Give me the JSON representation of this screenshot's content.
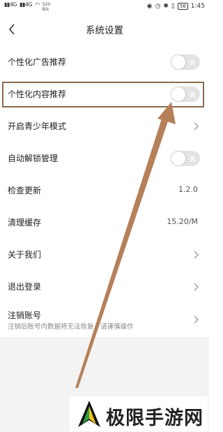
{
  "statusbar": {
    "signal_1": "4G",
    "signal_2": "4G",
    "net_speed_value": "520",
    "net_speed_unit": "B/s",
    "battery": "56",
    "time": "1:45"
  },
  "header": {
    "title": "系统设置"
  },
  "settings": {
    "personalized_ads": {
      "label": "个性化广告推荐",
      "toggle_label": "关",
      "on": false
    },
    "personalized_content": {
      "label": "个性化内容推荐",
      "toggle_label": "关",
      "on": false
    },
    "youth_mode": {
      "label": "开启青少年模式"
    },
    "auto_unlock": {
      "label": "自动解锁管理",
      "toggle_label": "关",
      "on": false
    },
    "check_update": {
      "label": "检查更新",
      "value": "1.2.0"
    },
    "clear_cache": {
      "label": "清理缓存",
      "value": "15.20/M"
    },
    "about": {
      "label": "关于我们"
    },
    "logout": {
      "label": "退出登录"
    },
    "delete_account": {
      "label": "注销账号",
      "sublabel": "注销后账号内数据将无法恢复，请谨慎操作"
    }
  },
  "watermark": {
    "text": "极限手游网"
  },
  "colors": {
    "highlight_border": "#8a6a4d",
    "arrow": "#b5805a",
    "toggle_off": "#e3e3e3",
    "watermark_green": "#2f9e44"
  }
}
